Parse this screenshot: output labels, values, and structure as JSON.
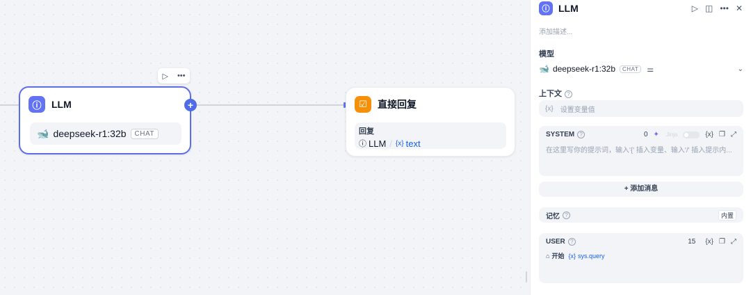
{
  "canvas": {
    "llm_node": {
      "title": "LLM",
      "model": "deepseek-r1:32b",
      "mode": "CHAT",
      "toolbar": {
        "run_icon": "play-icon",
        "more_icon": "more-icon"
      }
    },
    "reply_node": {
      "title": "直接回复",
      "field_label": "回复",
      "var_source": "LLM",
      "var_name": "text"
    }
  },
  "panel": {
    "title": "LLM",
    "description_placeholder": "添加描述...",
    "model_label": "模型",
    "model_name": "deepseek-r1:32b",
    "model_mode": "CHAT",
    "context_label": "上下文",
    "context_placeholder": "设置变量值",
    "system": {
      "label": "SYSTEM",
      "count": "0",
      "jinja": "Jinja",
      "placeholder": "在这里写你的提示词，输入'{' 插入变量、输入'/' 插入提示内..."
    },
    "add_message": "+ 添加消息",
    "memory_label": "记忆",
    "memory_badge": "内置",
    "user": {
      "label": "USER",
      "count": "15",
      "var_node": "开始",
      "var_name": "sys.query"
    }
  },
  "colors": {
    "accent": "#6172f3",
    "reply": "#f79009",
    "var": "#155eef"
  }
}
